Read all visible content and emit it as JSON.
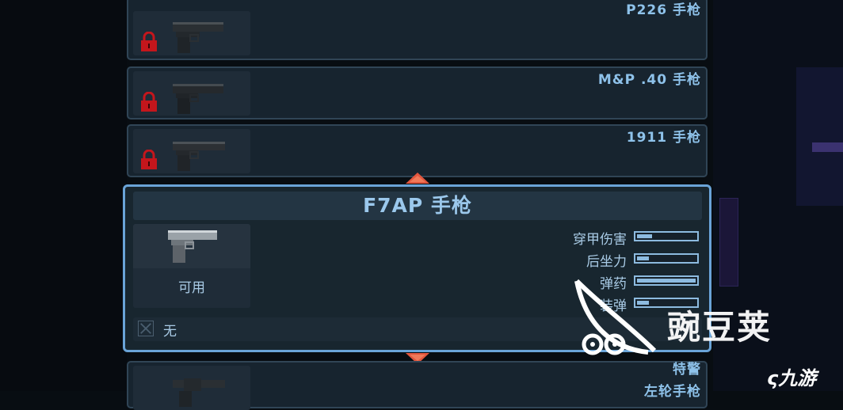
{
  "weapon_list": [
    {
      "name": "P226 手枪",
      "locked": true
    },
    {
      "name": "M&P .40 手枪",
      "locked": true
    },
    {
      "name": "1911 手枪",
      "locked": true
    }
  ],
  "selected": {
    "title": "F7AP 手枪",
    "status": "可用",
    "attachment": "无",
    "stats": [
      {
        "label": "穿甲伤害",
        "value": 0.25
      },
      {
        "label": "后坐力",
        "value": 0.2
      },
      {
        "label": "弹药",
        "value": 1.0
      },
      {
        "label": "装弹",
        "value": 0.2
      }
    ]
  },
  "next_items": [
    {
      "name": "特警"
    },
    {
      "name": "左轮手枪"
    }
  ],
  "watermark": {
    "brand": "豌豆荚",
    "site": "九游"
  },
  "colors": {
    "accent": "#6aa4d8",
    "lock": "#c4161c",
    "text": "#8ec2ea"
  }
}
